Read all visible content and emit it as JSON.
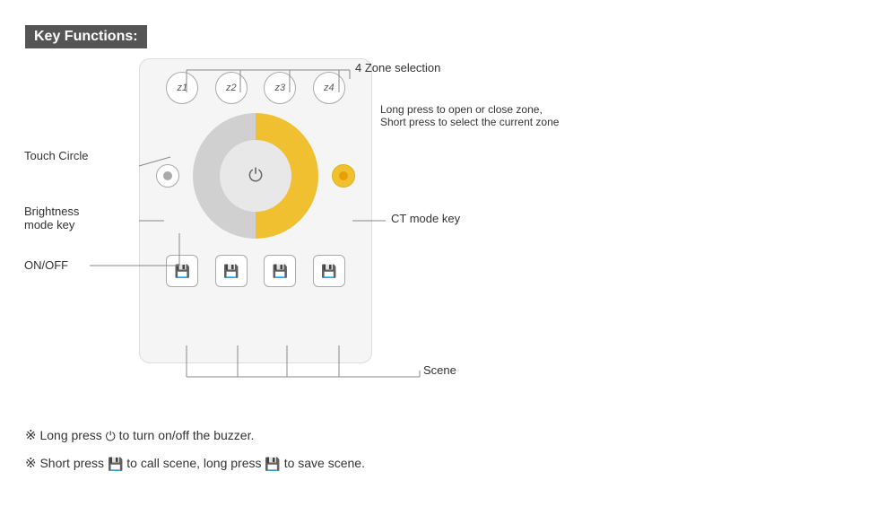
{
  "header": {
    "title": "Key Functions:"
  },
  "zones": {
    "label": "4 Zone selection",
    "sublabel": "Long press to open or close zone,",
    "sublabel2": "Short press to select the current zone",
    "buttons": [
      "z1",
      "z2",
      "z3",
      "z4"
    ]
  },
  "annotations": {
    "touch_circle": "Touch Circle",
    "brightness_mode": "Brightness\nmode key",
    "on_off": "ON/OFF",
    "ct_mode": "CT mode key",
    "scene": "Scene"
  },
  "notes": {
    "line1_prefix": "※ Long press",
    "line1_icon": "⏻",
    "line1_suffix": " to turn on/off the buzzer.",
    "line2_prefix": "※ Short press",
    "line2_icon": "💾",
    "line2_mid": " to call scene, long press ",
    "line2_icon2": "💾",
    "line2_suffix": " to save scene."
  }
}
